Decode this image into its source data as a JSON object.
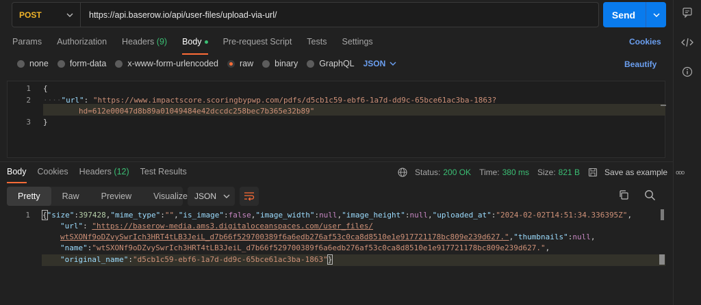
{
  "request": {
    "method": "POST",
    "url": "https://api.baserow.io/api/user-files/upload-via-url/",
    "send_label": "Send"
  },
  "request_tabs": [
    {
      "label": "Params"
    },
    {
      "label": "Authorization"
    },
    {
      "label": "Headers",
      "count": "(9)"
    },
    {
      "label": "Body"
    },
    {
      "label": "Pre-request Script"
    },
    {
      "label": "Tests"
    },
    {
      "label": "Settings"
    }
  ],
  "cookies_label": "Cookies",
  "body_types": [
    "none",
    "form-data",
    "x-www-form-urlencoded",
    "raw",
    "binary",
    "GraphQL"
  ],
  "body_format": "JSON",
  "beautify_label": "Beautify",
  "request_body": {
    "line_numbers": [
      "1",
      "2",
      "3"
    ],
    "l1": "{",
    "key": "\"url\"",
    "colon": ": ",
    "value_part1": "\"https://www.impactscore.scoringbypwp.com/pdfs/d5cb1c59-ebf6-1a7d-dd9c-65bce61ac3ba-1863?",
    "value_part2": "hd=612e00047d8b89a01049484e42dccdc258bec7b365e32b89\"",
    "l3": "}"
  },
  "response_tabs": [
    {
      "label": "Body"
    },
    {
      "label": "Cookies"
    },
    {
      "label": "Headers",
      "count": "(12)"
    },
    {
      "label": "Test Results"
    }
  ],
  "response_status": {
    "status_label": "Status:",
    "status_value": "200 OK",
    "time_label": "Time:",
    "time_value": "380 ms",
    "size_label": "Size:",
    "size_value": "821 B",
    "save_label": "Save as example",
    "more": "ooo"
  },
  "view_modes": [
    "Pretty",
    "Raw",
    "Preview",
    "Visualize"
  ],
  "response_format": "JSON",
  "response_body": {
    "line_number": "1",
    "size_key": "\"size\"",
    "size_val": "397428",
    "mime_key": "\"mime_type\"",
    "mime_val": "\"\"",
    "isimg_key": "\"is_image\"",
    "isimg_val": "false",
    "iw_key": "\"image_width\"",
    "iw_val": "null",
    "ih_key": "\"image_height\"",
    "ih_val": "null",
    "up_key": "\"uploaded_at\"",
    "up_val": "\"2024-02-02T14:51:34.336395Z\"",
    "url_key": "\"url\"",
    "url_val1": "\"https://baserow-media.ams3.digitaloceanspaces.com/user_files/",
    "url_val2": "wtSXONf9oDZvySwrIch3HRT4tLB3JeiL_d7b66f529700389f6a6edb276af53c0ca8d8510e1e917721178bc809e239d627.\"",
    "thumb_key": "\"thumbnails\"",
    "thumb_val": "null",
    "name_key": "\"name\"",
    "name_val": "\"wtSXONf9oDZvySwrIch3HRT4tLB3JeiL_d7b66f529700389f6a6edb276af53c0ca8d8510e1e917721178bc809e239d627.\"",
    "oname_key": "\"original_name\"",
    "oname_val": "\"d5cb1c59-ebf6-1a7d-dd9c-65bce61ac3ba-1863\""
  },
  "colors": {
    "accent": "#ff6c37",
    "send": "#097bed",
    "link": "#6b9ff0",
    "success": "#3bbf74",
    "method": "#f0b429"
  }
}
